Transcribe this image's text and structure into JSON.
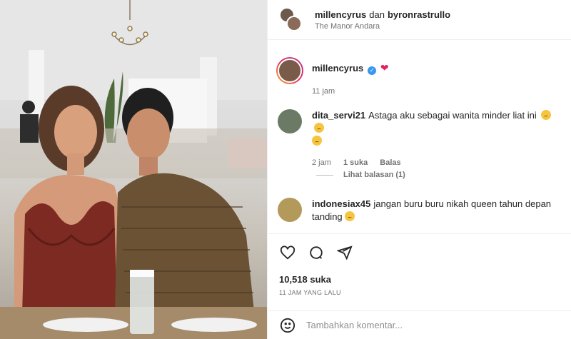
{
  "header": {
    "user1": "millencyrus",
    "conjunction": "dan",
    "user2": "byronrastrullo",
    "location": "The Manor Andara"
  },
  "caption": {
    "username": "millencyrus",
    "verified": true,
    "text": "❤",
    "time": "11 jam"
  },
  "comments": [
    {
      "username": "dita_servi21",
      "text": "Astaga aku sebagai wanita minder liat ini",
      "time": "2 jam",
      "likes": "1 suka",
      "reply": "Balas",
      "view_replies": "Lihat balasan (1)"
    },
    {
      "username": "indonesiax45",
      "text": "jangan buru buru nikah queen tahun depan tanding"
    }
  ],
  "post": {
    "likes": "10,518 suka",
    "time_ago": "11 JAM YANG LALU"
  },
  "add_comment": {
    "placeholder": "Tambahkan komentar..."
  },
  "icons": [
    "heart-icon",
    "comment-icon",
    "share-icon",
    "emoji-icon"
  ]
}
